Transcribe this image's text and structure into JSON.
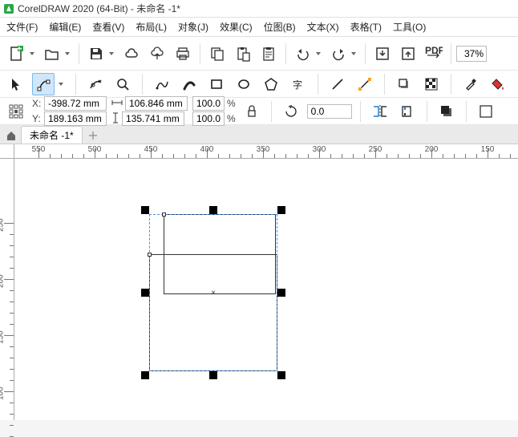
{
  "title": "CorelDRAW 2020 (64-Bit) - 未命名 -1*",
  "menu": {
    "file": "文件(F)",
    "edit": "编辑(E)",
    "view": "查看(V)",
    "layout": "布局(L)",
    "object": "对象(J)",
    "effects": "效果(C)",
    "bitmap": "位图(B)",
    "text": "文本(X)",
    "table": "表格(T)",
    "tools": "工具(O)"
  },
  "zoom": "37%",
  "props": {
    "x": "-398.72 mm",
    "y": "189.163 mm",
    "w": "106.846 mm",
    "h": "135.741 mm",
    "sx": "100.0",
    "sy": "100.0",
    "rot": "0.0",
    "x_label": "X:",
    "y_label": "Y:",
    "pct1": "%",
    "pct2": "%"
  },
  "docTab": "未命名 -1*",
  "ruler_h": [
    "550",
    "500",
    "450",
    "400",
    "350",
    "300",
    "250",
    "200",
    "150"
  ],
  "ruler_v": [
    "250",
    "200",
    "150",
    "100"
  ]
}
